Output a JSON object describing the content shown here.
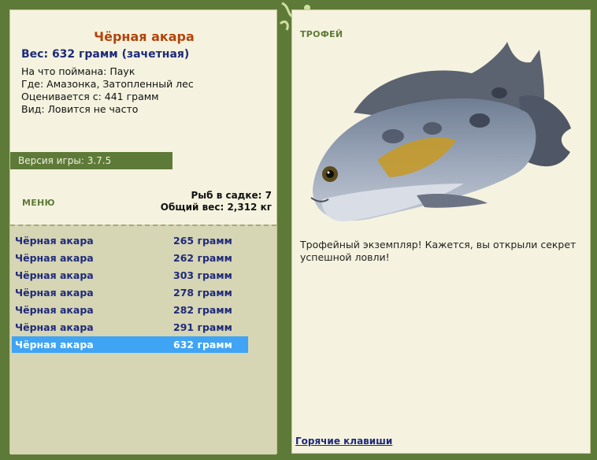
{
  "catch": {
    "title": "Чёрная акара",
    "weight_line": "Вес: 632 грамм (зачетная)",
    "bait": "На что поймана: Паук",
    "place": "Где: Амазонка, Затопленный лес",
    "value_from": "Оценивается с: 441 грамм",
    "frequency": "Вид: Ловится не часто"
  },
  "version": "Версия игры: 3.7.5",
  "menu_label": "МЕНЮ",
  "cage": {
    "count": "Рыб в садке: 7",
    "total": "Общий вес: 2,312 кг"
  },
  "fish_list": [
    {
      "name": "Чёрная акара",
      "weight": "265 грамм"
    },
    {
      "name": "Чёрная акара",
      "weight": "262 грамм"
    },
    {
      "name": "Чёрная акара",
      "weight": "303 грамм"
    },
    {
      "name": "Чёрная акара",
      "weight": "278 грамм"
    },
    {
      "name": "Чёрная акара",
      "weight": "282 грамм"
    },
    {
      "name": "Чёрная акара",
      "weight": "291 грамм"
    },
    {
      "name": "Чёрная акара",
      "weight": "632 грамм"
    }
  ],
  "selected_index": 6,
  "trophy": {
    "label": "ТРОФЕЙ",
    "text": "Трофейный экземпляр! Кажется, вы открыли секрет успешной ловли!"
  },
  "hotkeys": "Горячие клавиши",
  "colors": {
    "frame": "#5e7a38",
    "panel": "#f5f3df",
    "list_bg": "#d6d5b4",
    "selection": "#3fa4f4",
    "title": "#b4430b",
    "link": "#1e2a7a"
  }
}
